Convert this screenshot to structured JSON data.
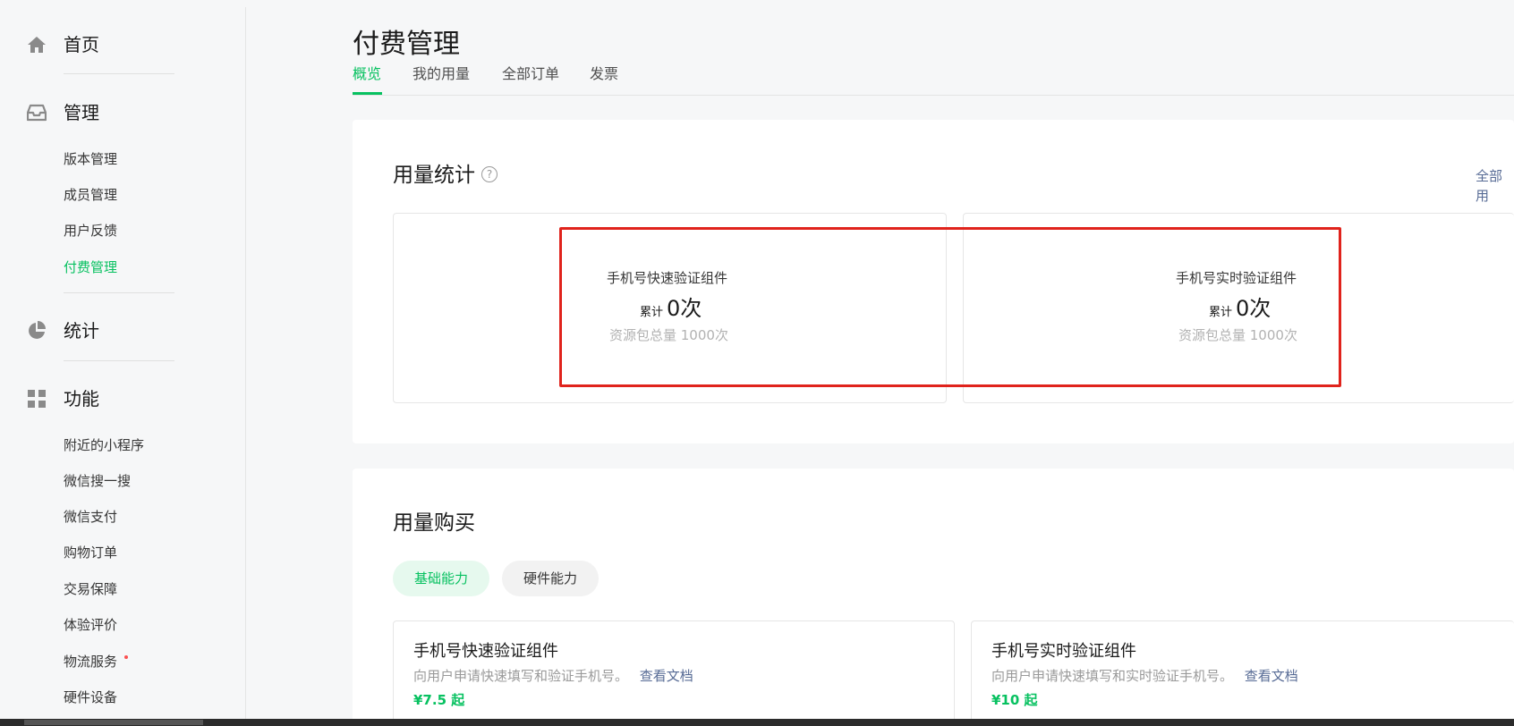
{
  "sidebar": {
    "home": {
      "icon": "home-icon",
      "label": "首页"
    },
    "manage": {
      "icon": "inbox-icon",
      "label": "管理",
      "items": [
        {
          "label": "版本管理"
        },
        {
          "label": "成员管理"
        },
        {
          "label": "用户反馈"
        },
        {
          "label": "付费管理",
          "active": true
        }
      ]
    },
    "stats": {
      "icon": "pie-chart-icon",
      "label": "统计"
    },
    "features": {
      "icon": "grid-icon",
      "label": "功能",
      "items": [
        {
          "label": "附近的小程序"
        },
        {
          "label": "微信搜一搜"
        },
        {
          "label": "微信支付"
        },
        {
          "label": "购物订单"
        },
        {
          "label": "交易保障"
        },
        {
          "label": "体验评价"
        },
        {
          "label": "物流服务",
          "badge_dot": true
        },
        {
          "label": "硬件设备"
        }
      ]
    }
  },
  "page": {
    "title": "付费管理"
  },
  "tabs": [
    {
      "label": "概览",
      "active": true
    },
    {
      "label": "我的用量"
    },
    {
      "label": "全部订单"
    },
    {
      "label": "发票"
    }
  ],
  "usage_stats": {
    "title": "用量统计",
    "help_icon": "question-circle-icon",
    "all_link": "全部用",
    "items": [
      {
        "name": "手机号快速验证组件",
        "prefix": "累计",
        "value": "0次",
        "total": "资源包总量 1000次"
      },
      {
        "name": "手机号实时验证组件",
        "prefix": "累计",
        "value": "0次",
        "total": "资源包总量 1000次"
      }
    ]
  },
  "purchase": {
    "title": "用量购买",
    "filters": [
      {
        "label": "基础能力",
        "active": true
      },
      {
        "label": "硬件能力"
      }
    ],
    "products": [
      {
        "name": "手机号快速验证组件",
        "desc": "向用户申请快速填写和验证手机号。",
        "doc_link": "查看文档",
        "price": "¥7.5 起"
      },
      {
        "name": "手机号实时验证组件",
        "desc": "向用户申请快速填写和实时验证手机号。",
        "doc_link": "查看文档",
        "price": "¥10 起"
      }
    ]
  },
  "colors": {
    "accent": "#07c160",
    "link": "#576b95",
    "highlight": "#e0231c"
  }
}
